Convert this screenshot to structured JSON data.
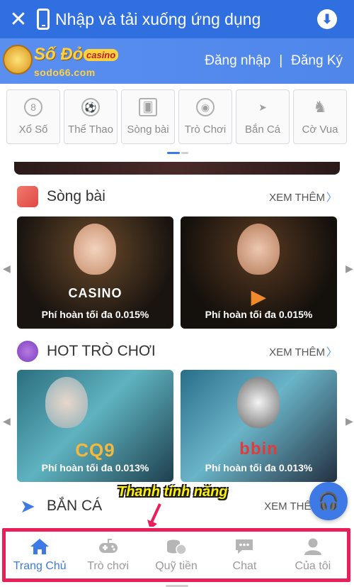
{
  "topbar": {
    "title": "Nhập và tải xuống ứng dụng",
    "close_icon": "close-icon",
    "download_icon": "download-icon"
  },
  "header": {
    "logo_text": "Số Đỏ",
    "logo_badge": "casino",
    "logo_domain": "sodo66.com",
    "login": "Đăng nhập",
    "separator": "|",
    "register": "Đăng Ký"
  },
  "categories": [
    {
      "label": "Xổ Số",
      "icon": "lottery-ball-icon",
      "glyph": "8"
    },
    {
      "label": "Thể Thao",
      "icon": "soccer-ball-icon",
      "glyph": "⚽"
    },
    {
      "label": "Sòng bài",
      "icon": "cards-icon",
      "glyph": "🂠"
    },
    {
      "label": "Trò Chơi",
      "icon": "roulette-icon",
      "glyph": "◉"
    },
    {
      "label": "Bắn Cá",
      "icon": "fish-icon",
      "glyph": "➤"
    },
    {
      "label": "Cờ Vua",
      "icon": "chess-knight-icon",
      "glyph": "♞"
    }
  ],
  "sections": {
    "casino": {
      "title": "Sòng bài",
      "more": "XEM THÊM",
      "tiles": [
        {
          "brand": "CASINO",
          "caption": "Phí hoàn tối đa 0.015%"
        },
        {
          "brand": "",
          "caption": "Phí hoàn tối đa 0.015%"
        }
      ]
    },
    "games": {
      "title": "HOT TRÒ CHƠI",
      "more": "XEM THÊM",
      "tiles": [
        {
          "brand": "CQ9",
          "caption": "Phí hoàn tối đa 0.013%"
        },
        {
          "brand": "bbin",
          "caption": "Phí hoàn tối đa 0.013%"
        }
      ]
    },
    "fishing": {
      "title": "BẮN CÁ",
      "more": "XEM THÊM"
    }
  },
  "callout": "Thanh tính năng",
  "bottom_nav": [
    {
      "label": "Trang Chủ",
      "icon": "home-icon",
      "active": true
    },
    {
      "label": "Trò chơi",
      "icon": "gamepad-icon",
      "active": false
    },
    {
      "label": "Quỹ tiền",
      "icon": "coins-icon",
      "active": false
    },
    {
      "label": "Chat",
      "icon": "chat-icon",
      "active": false
    },
    {
      "label": "Của tôi",
      "icon": "user-icon",
      "active": false
    }
  ],
  "colors": {
    "primary": "#3d7ae6",
    "header": "#5a8ff0",
    "highlight_frame": "#ea1f5a",
    "callout": "#fff200"
  }
}
